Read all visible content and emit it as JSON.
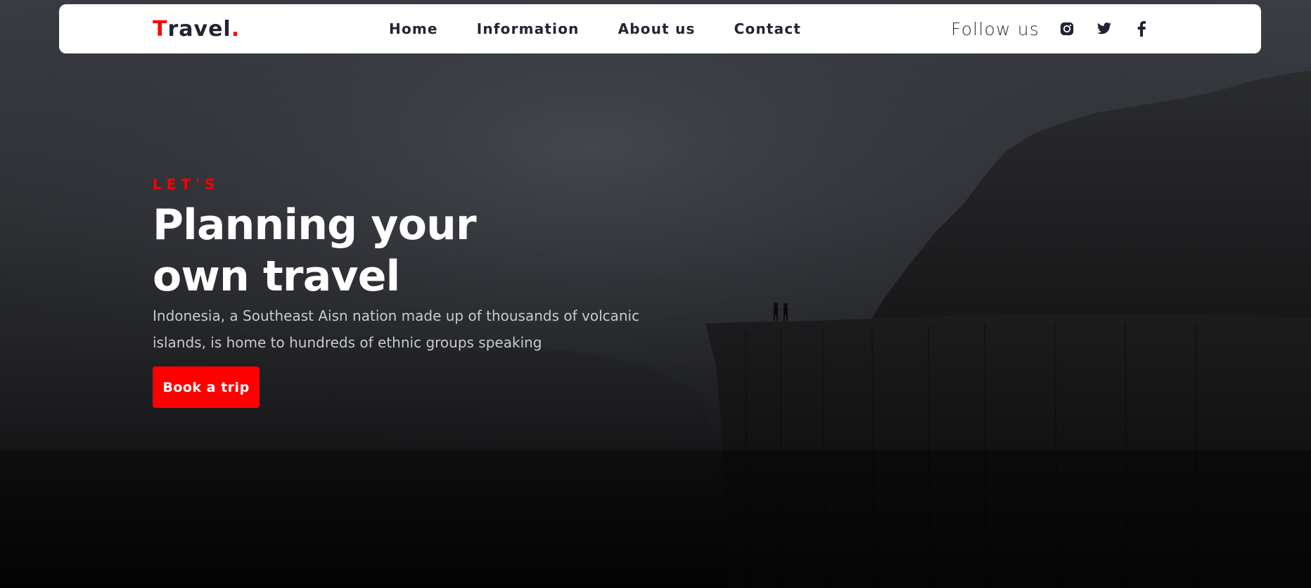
{
  "brand": {
    "first_letter": "T",
    "rest": "ravel",
    "dot": "."
  },
  "nav": {
    "items": [
      {
        "label": "Home"
      },
      {
        "label": "Information"
      },
      {
        "label": "About us"
      },
      {
        "label": "Contact"
      }
    ]
  },
  "follow": {
    "label": "Follow us",
    "icons": [
      "instagram-icon",
      "twitter-icon",
      "facebook-icon"
    ]
  },
  "hero": {
    "eyebrow": "LET'S",
    "headline_line1": "Planning your",
    "headline_line2": "own travel",
    "desc_line1": "Indonesia, a Southeast Aisn nation made up of thousands of volcanic",
    "desc_line2": "islands, is home to hundreds of ethnic groups speaking",
    "cta_label": "Book a trip"
  },
  "colors": {
    "accent": "#ff0000",
    "nav_bg": "#ffffff",
    "text_dark": "#1f2430",
    "hero_text": "#ffffff",
    "desc_text": "#c8cacf"
  }
}
